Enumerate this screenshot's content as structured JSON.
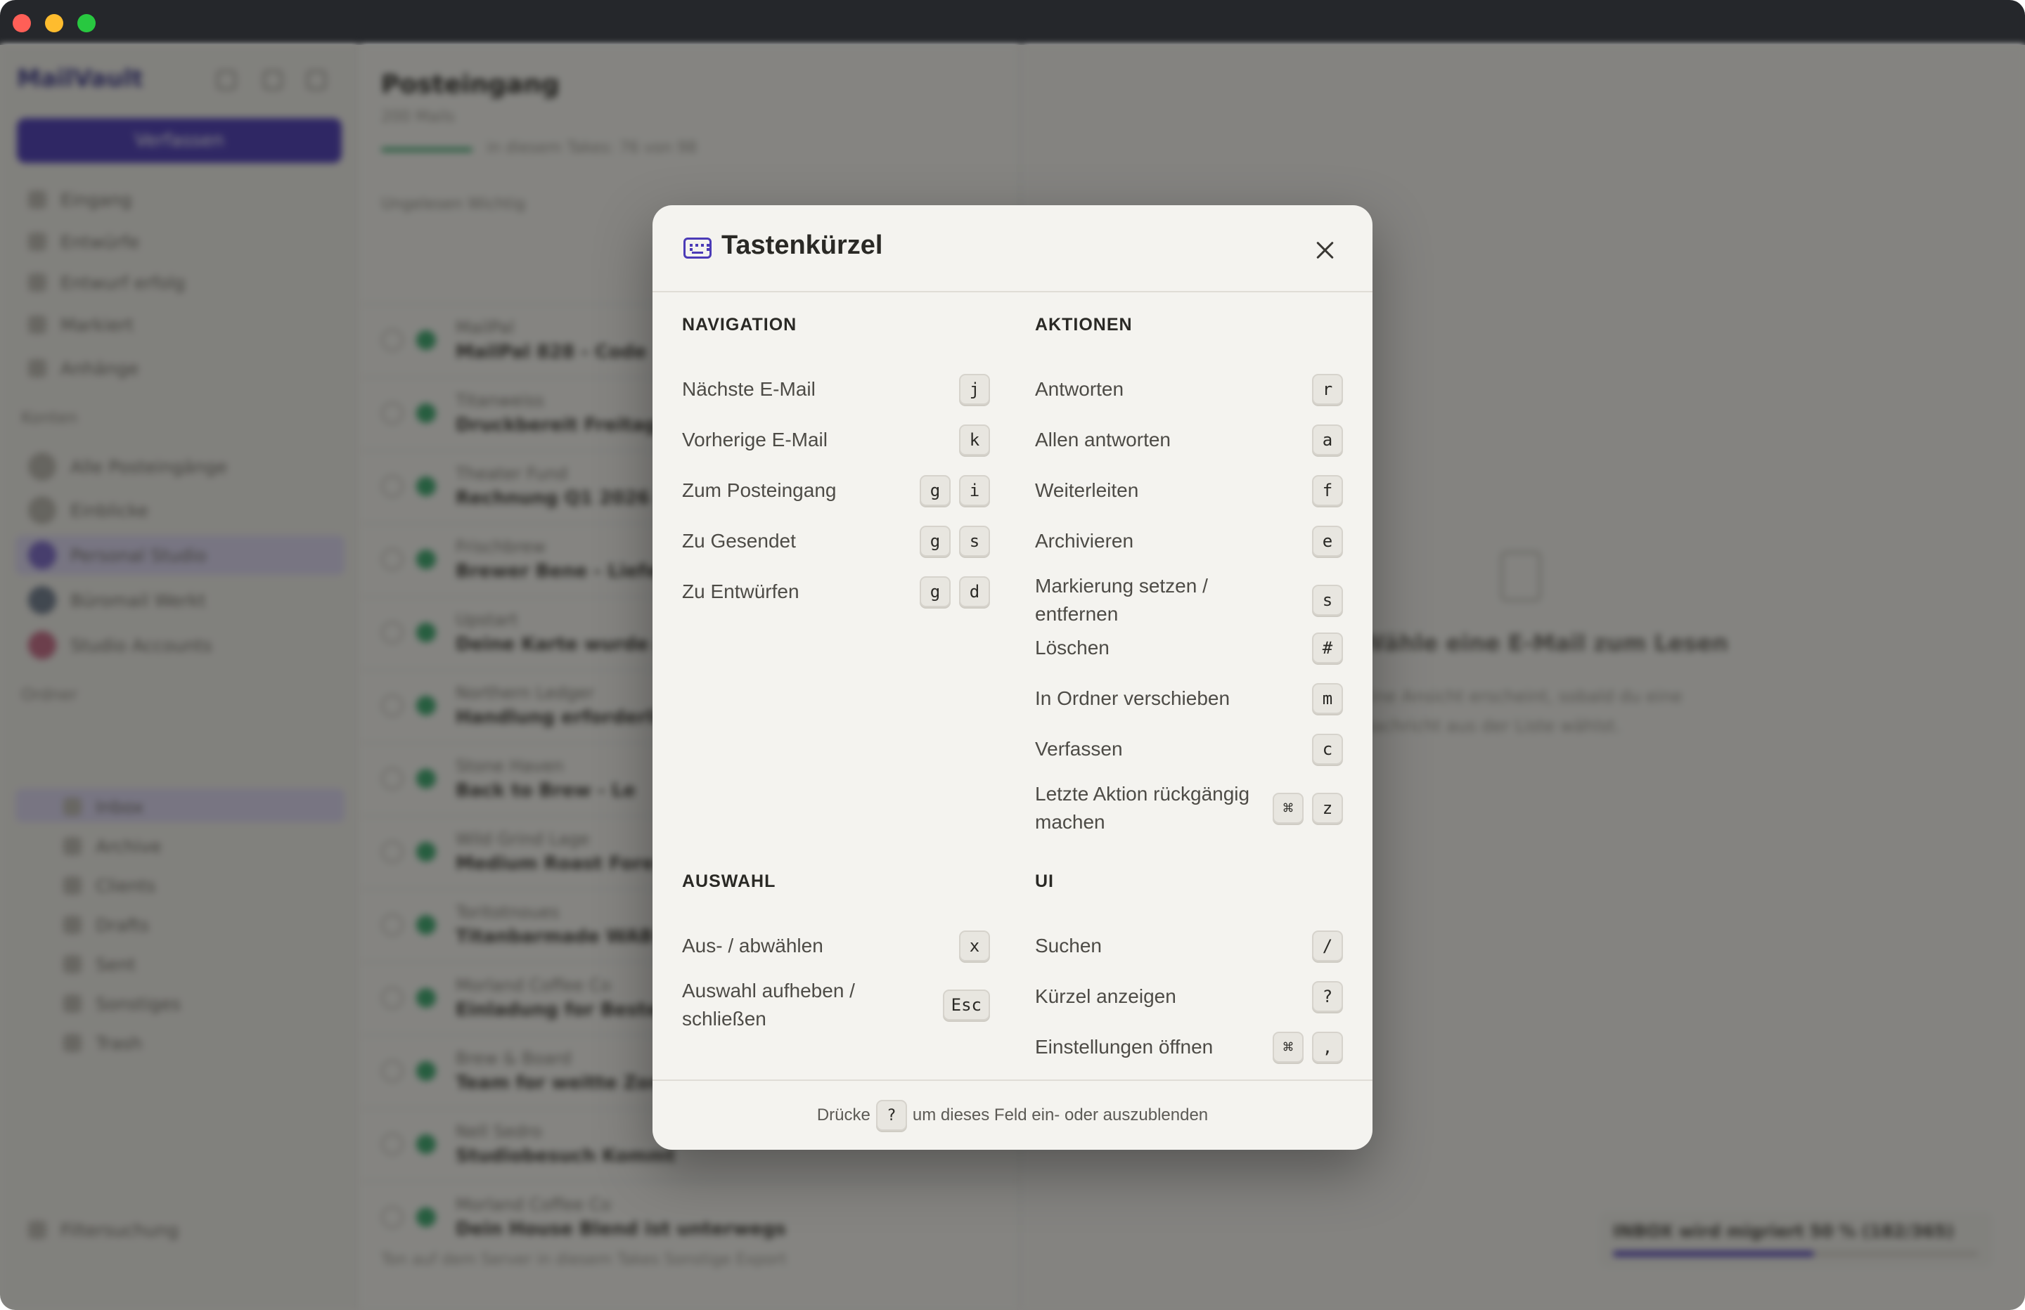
{
  "window": {
    "traffic_lights": [
      "close",
      "minimize",
      "zoom"
    ]
  },
  "background": {
    "sidebar": {
      "brand": "MailVault",
      "compose_label": "Verfassen",
      "nav": [
        "Eingang",
        "Entwürfe",
        "Entwurf erfolg",
        "Markiert",
        "Anhänge"
      ],
      "accounts_heading": "Konten",
      "accounts": [
        "Alle Posteingänge",
        "Einblicke",
        "Personal Studio",
        "Büromail Werkt",
        "Studio Accounts"
      ],
      "folders_heading": "Ordner",
      "folders": [
        "Inbox",
        "Archive",
        "Clients",
        "Drafts",
        "Sent",
        "Sonstiges",
        "Trash"
      ],
      "footer": "Filtersuchung"
    },
    "list": {
      "title": "Posteingang",
      "subtitle": "200 Mails",
      "progress_text": "in diesem Takes: 76 von 98",
      "toolbar": "Ungelesen   Wichtig",
      "rows": [
        {
          "from": "MailPal",
          "subject": "MailPal 828 - Code"
        },
        {
          "from": "Titanweiss",
          "subject": "Druckbereit Freitag"
        },
        {
          "from": "Theater Fund",
          "subject": "Rechnung Q1 2026"
        },
        {
          "from": "Frischbrew",
          "subject": "Brewer Bene - Liefer"
        },
        {
          "from": "Upstart",
          "subject": "Deine Karte wurde ak"
        },
        {
          "from": "Northern Ledger",
          "subject": "Handlung erforderlich"
        },
        {
          "from": "Stone Haven",
          "subject": "Back to Brew - Le"
        },
        {
          "from": "Wild Grind Lage",
          "subject": "Medium Roast Fore"
        },
        {
          "from": "Toritotnoues",
          "subject": "Titanbarmade WAB"
        },
        {
          "from": "Morland Coffee Co",
          "subject": "Einladung for Bestell"
        },
        {
          "from": "Brew & Board",
          "subject": "Team for weitte Zone"
        },
        {
          "from": "Nell Sedro",
          "subject": "Studiobesuch Kommt"
        },
        {
          "from": "Morland Coffee Co",
          "subject": "Dein House Blend ist unterwegs"
        }
      ],
      "footer": "Ton auf dem Server   in diesem Takes   Sonstige Export"
    },
    "reader": {
      "empty_title": "Wähle eine E-Mail zum Lesen",
      "empty_text": "Eine Ansicht erscheint, sobald du eine Nachricht aus der Liste wählst.",
      "toast": "INBOX wird migriert 50 % (182/365)",
      "toast_progress": 0.55
    }
  },
  "modal": {
    "title": "Tastenkürzel",
    "icon": "keyboard-icon",
    "accent": "#4b3bb7",
    "sections": {
      "navigation": {
        "heading": "NAVIGATION",
        "items": [
          {
            "label": "Nächste E-Mail",
            "keys": [
              "j"
            ]
          },
          {
            "label": "Vorherige E-Mail",
            "keys": [
              "k"
            ]
          },
          {
            "label": "Zum Posteingang",
            "keys": [
              "g",
              "i"
            ]
          },
          {
            "label": "Zu Gesendet",
            "keys": [
              "g",
              "s"
            ]
          },
          {
            "label": "Zu Entwürfen",
            "keys": [
              "g",
              "d"
            ]
          }
        ]
      },
      "actions": {
        "heading": "AKTIONEN",
        "items": [
          {
            "label": "Antworten",
            "keys": [
              "r"
            ]
          },
          {
            "label": "Allen antworten",
            "keys": [
              "a"
            ]
          },
          {
            "label": "Weiterleiten",
            "keys": [
              "f"
            ]
          },
          {
            "label": "Archivieren",
            "keys": [
              "e"
            ]
          },
          {
            "label": "Markierung setzen / entfernen",
            "keys": [
              "s"
            ]
          },
          {
            "label": "Löschen",
            "keys": [
              "#"
            ]
          },
          {
            "label": "In Ordner verschieben",
            "keys": [
              "m"
            ]
          },
          {
            "label": "Verfassen",
            "keys": [
              "c"
            ]
          },
          {
            "label": "Letzte Aktion rückgängig machen",
            "keys": [
              "⌘",
              "z"
            ]
          }
        ]
      },
      "selection": {
        "heading": "AUSWAHL",
        "items": [
          {
            "label": "Aus- / abwählen",
            "keys": [
              "x"
            ]
          },
          {
            "label": "Auswahl aufheben / schließen",
            "keys": [
              "Esc"
            ]
          }
        ]
      },
      "ui": {
        "heading": "UI",
        "items": [
          {
            "label": "Suchen",
            "keys": [
              "/"
            ]
          },
          {
            "label": "Kürzel anzeigen",
            "keys": [
              "?"
            ]
          },
          {
            "label": "Einstellungen öffnen",
            "keys": [
              "⌘",
              ","
            ]
          }
        ]
      }
    },
    "footer": {
      "before": "Drücke",
      "key": "?",
      "after": "um dieses Feld ein- oder auszublenden"
    }
  }
}
